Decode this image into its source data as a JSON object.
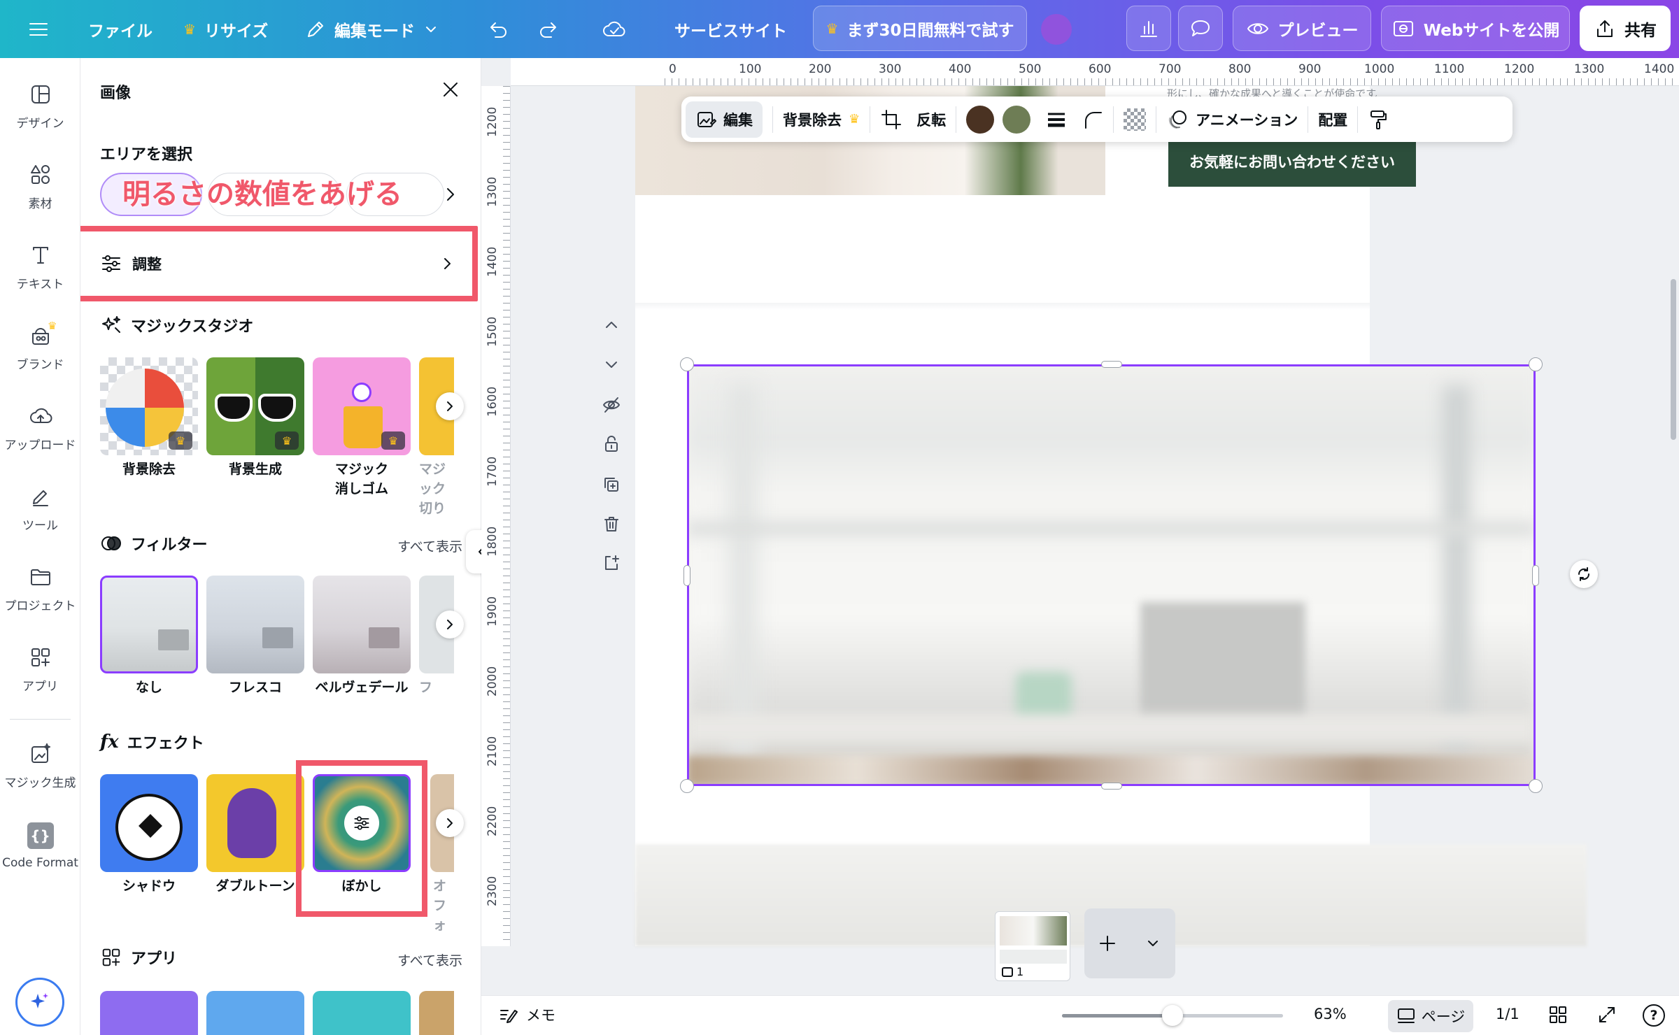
{
  "topbar": {
    "file": "ファイル",
    "resize": "リサイズ",
    "edit_mode": "編集モード",
    "site_name": "サービスサイト",
    "trial": "まず30日間無料で試す",
    "preview": "プレビュー",
    "publish": "Webサイトを公開",
    "share": "共有"
  },
  "rail": {
    "items": [
      {
        "label": "デザイン",
        "icon": "design-icon"
      },
      {
        "label": "素材",
        "icon": "elements-icon"
      },
      {
        "label": "テキスト",
        "icon": "text-icon"
      },
      {
        "label": "ブランド",
        "icon": "brand-icon"
      },
      {
        "label": "アップロード",
        "icon": "upload-icon"
      },
      {
        "label": "ツール",
        "icon": "tools-icon"
      },
      {
        "label": "プロジェクト",
        "icon": "folder-icon"
      },
      {
        "label": "アプリ",
        "icon": "apps-icon"
      },
      {
        "label": "マジック生成",
        "icon": "magic-generate-icon"
      },
      {
        "label": "Code Format",
        "icon": "code-icon"
      }
    ]
  },
  "panel": {
    "title": "画像",
    "select_area": "エリアを選択",
    "annotation": "明るさの数値をあげる",
    "adjust": "調整",
    "magic_studio": "マジックスタジオ",
    "magic_items": [
      "背景除去",
      "背景生成",
      "マジック\n消しゴム",
      "マジック\n切り"
    ],
    "filter": "フィルター",
    "see_all": "すべて表示",
    "filters": [
      "なし",
      "フレスコ",
      "ベルヴェデール",
      "フ"
    ],
    "effect": "エフェクト",
    "effects": [
      "シャドウ",
      "ダブルトーン",
      "ぼかし",
      "オ\nフォ"
    ],
    "apps": "アプリ",
    "apps_see_all": "すべて表示"
  },
  "ruler": {
    "top": [
      "0",
      "100",
      "200",
      "300",
      "400",
      "500",
      "600",
      "700",
      "800",
      "900",
      "1000",
      "1100",
      "1200",
      "1300",
      "1400"
    ],
    "left": [
      "1200",
      "1300",
      "1400",
      "1500",
      "1600",
      "1700",
      "1800",
      "1900",
      "2000",
      "2100",
      "2200",
      "2300"
    ]
  },
  "toolbar": {
    "edit": "編集",
    "bg_remove": "背景除去",
    "flip": "反転",
    "animation": "アニメーション",
    "position": "配置",
    "colors": [
      "#4a3222",
      "#6e7d55"
    ]
  },
  "page": {
    "cta_text": "お気軽にお問い合わせください",
    "clipped_text": "形にし、確かな成果へと導くことが使命です。"
  },
  "bottom": {
    "notes": "メモ",
    "zoom": "63%",
    "zoom_level": 0.5,
    "pages_label": "ページ",
    "page_count": "1/1",
    "thumb_page": "1"
  },
  "colors": {
    "selection": "#8b3dff",
    "annotation_red": "#f0586a"
  }
}
